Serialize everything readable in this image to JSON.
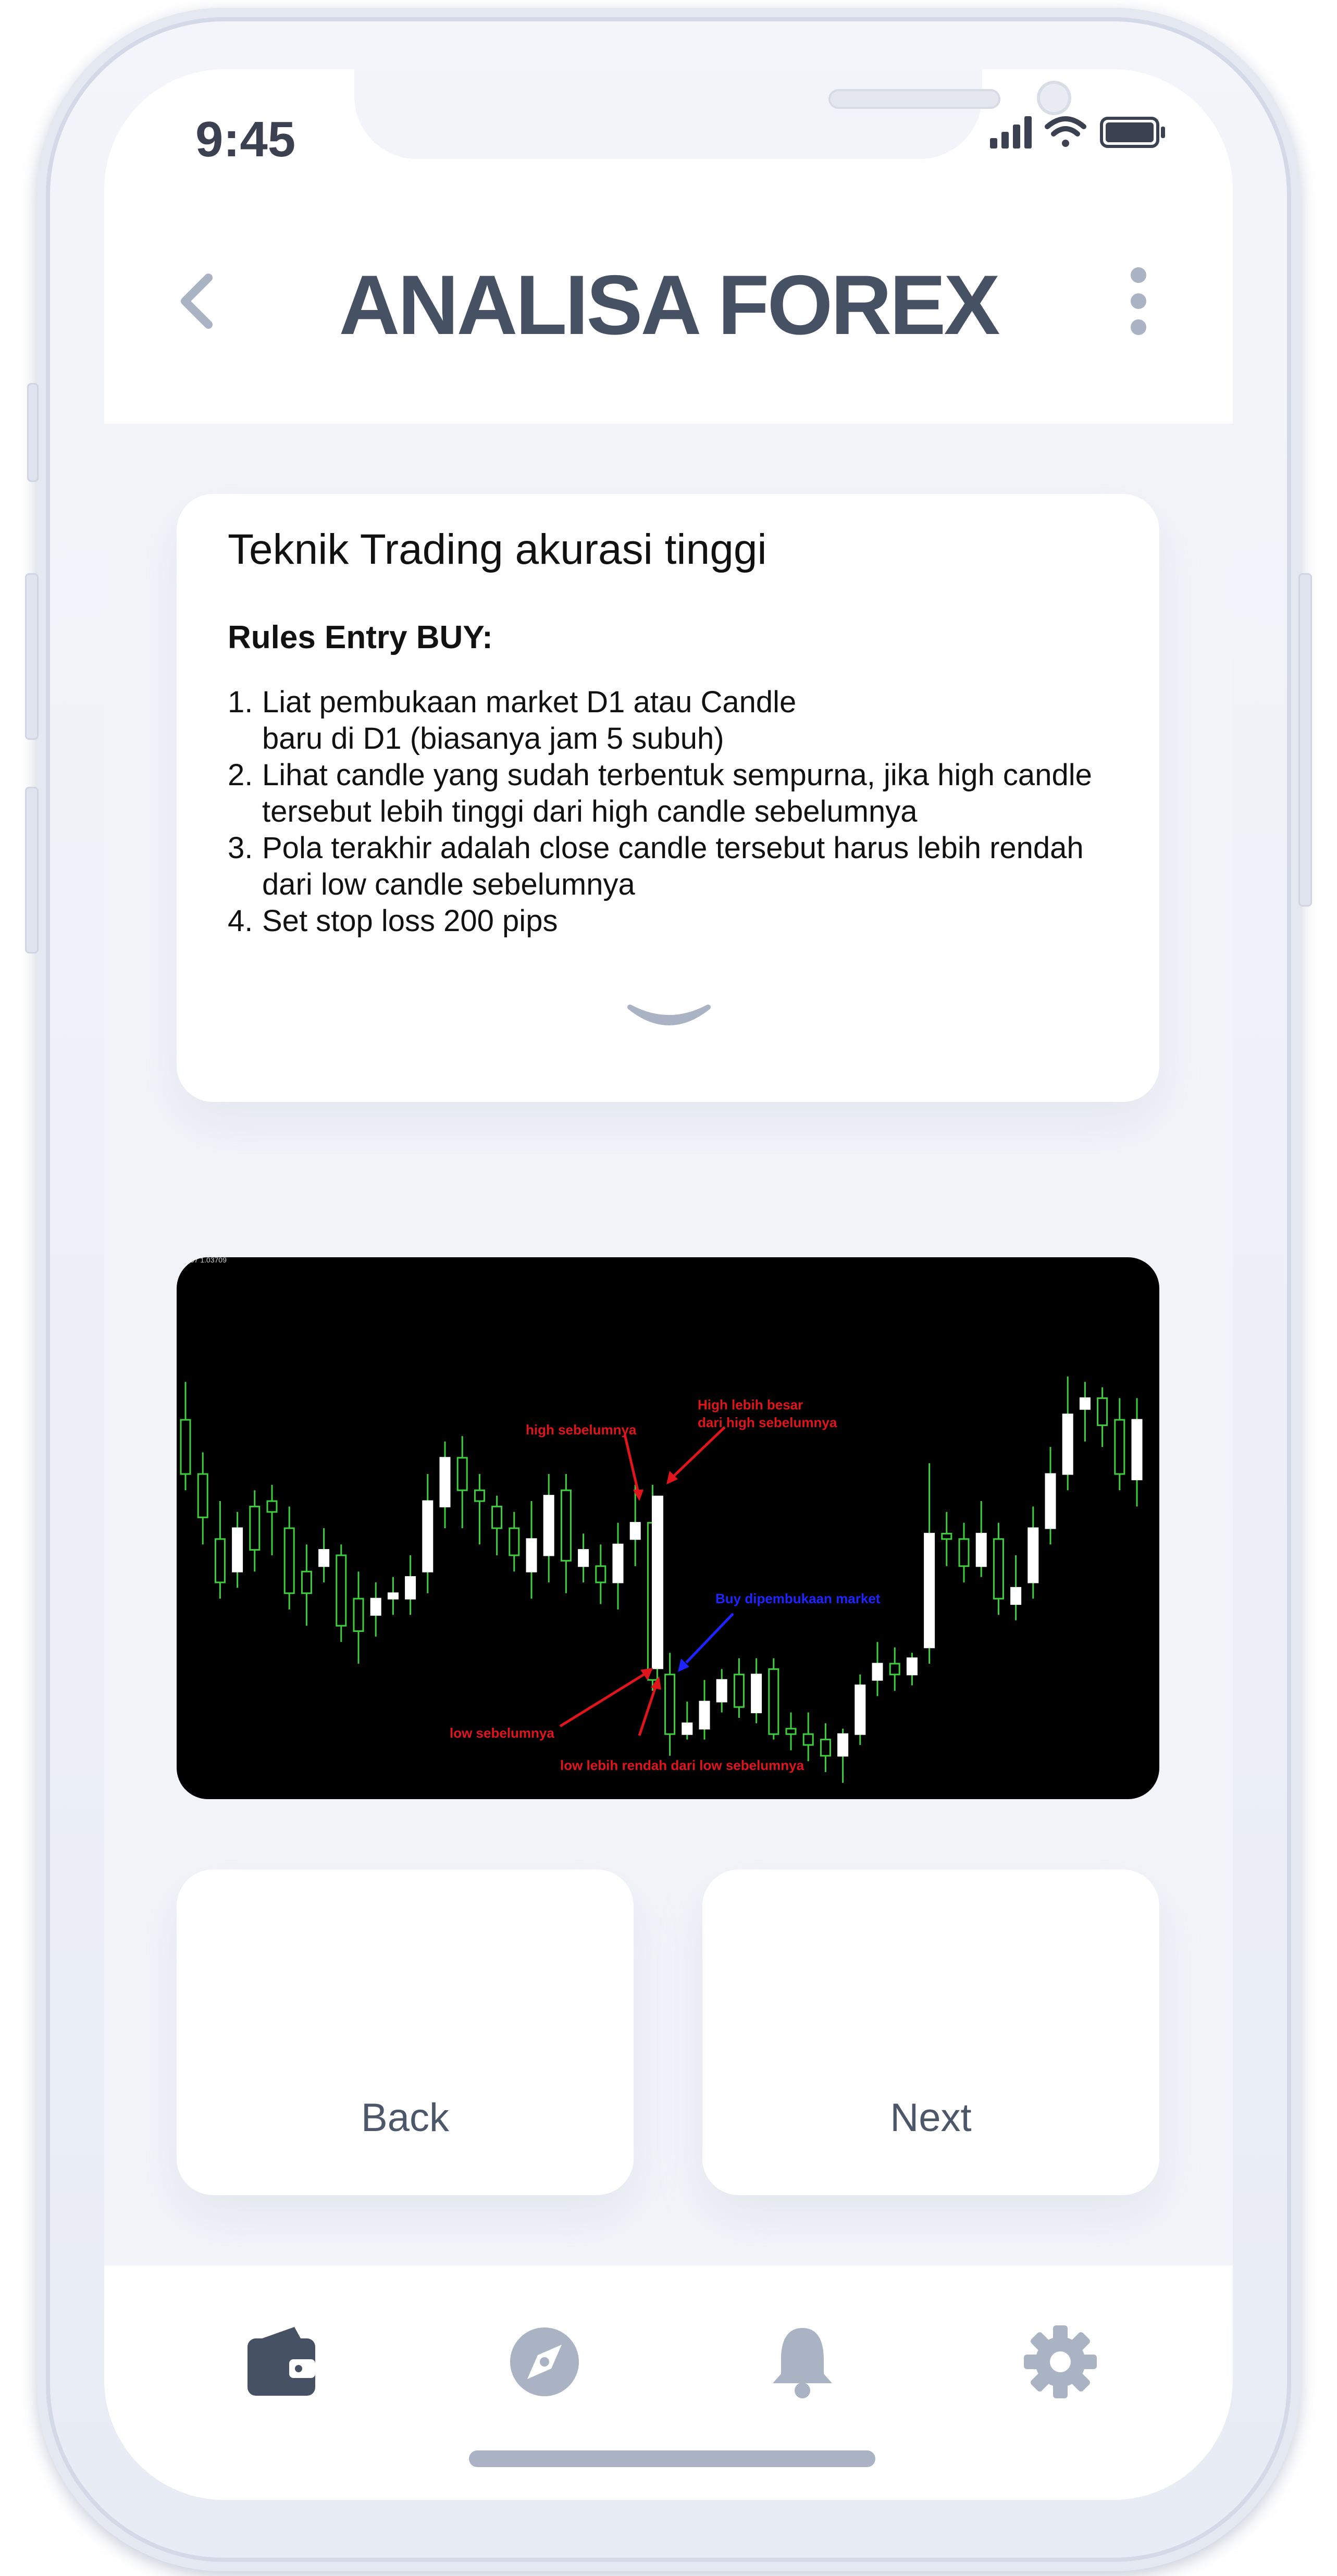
{
  "status_bar": {
    "time": "9:45"
  },
  "header": {
    "title": "ANALISA FOREX"
  },
  "card": {
    "title": "Teknik Trading akurasi tinggi",
    "subtitle": "Rules Entry BUY:",
    "rules": [
      {
        "num": "1.",
        "lines": [
          "Liat pembukaan market D1 atau Candle",
          "baru di D1 (biasanya jam 5 subuh)"
        ]
      },
      {
        "num": "2.",
        "lines": [
          "Lihat candle yang sudah terbentuk sempurna, jika high candle",
          "tersebut lebih tinggi dari high candle sebelumnya"
        ]
      },
      {
        "num": "3.",
        "lines": [
          "Pola terakhir adalah close candle tersebut harus lebih rendah",
          "dari low candle sebelumnya"
        ]
      },
      {
        "num": "4.",
        "lines": [
          "Set stop loss 200 pips"
        ]
      }
    ]
  },
  "chart_image": {
    "corner_text": "037 1.03709",
    "annotations": {
      "high_prev": "high sebelumnya",
      "high_bigger_1": "High lebih besar",
      "high_bigger_2": "dari high sebelumnya",
      "buy_open": "Buy dipembukaan market",
      "low_prev": "low sebelumnya",
      "low_lower": "low lebih rendah dari low sebelumnya"
    },
    "colors": {
      "bull": "#ffffff",
      "bear": "#ffffff",
      "wick": "#3ecf3e",
      "red_note": "#e0141b",
      "blue_note": "#1e24ff"
    }
  },
  "buttons": {
    "back": "Back",
    "next": "Next"
  },
  "tabbar": {
    "items": [
      "wallet-icon",
      "compass-icon",
      "bell-icon",
      "gear-icon"
    ],
    "active_index": 0
  },
  "colors": {
    "accent": "#465264",
    "muted": "#a9b3c4",
    "background": "#f2f4f9"
  }
}
